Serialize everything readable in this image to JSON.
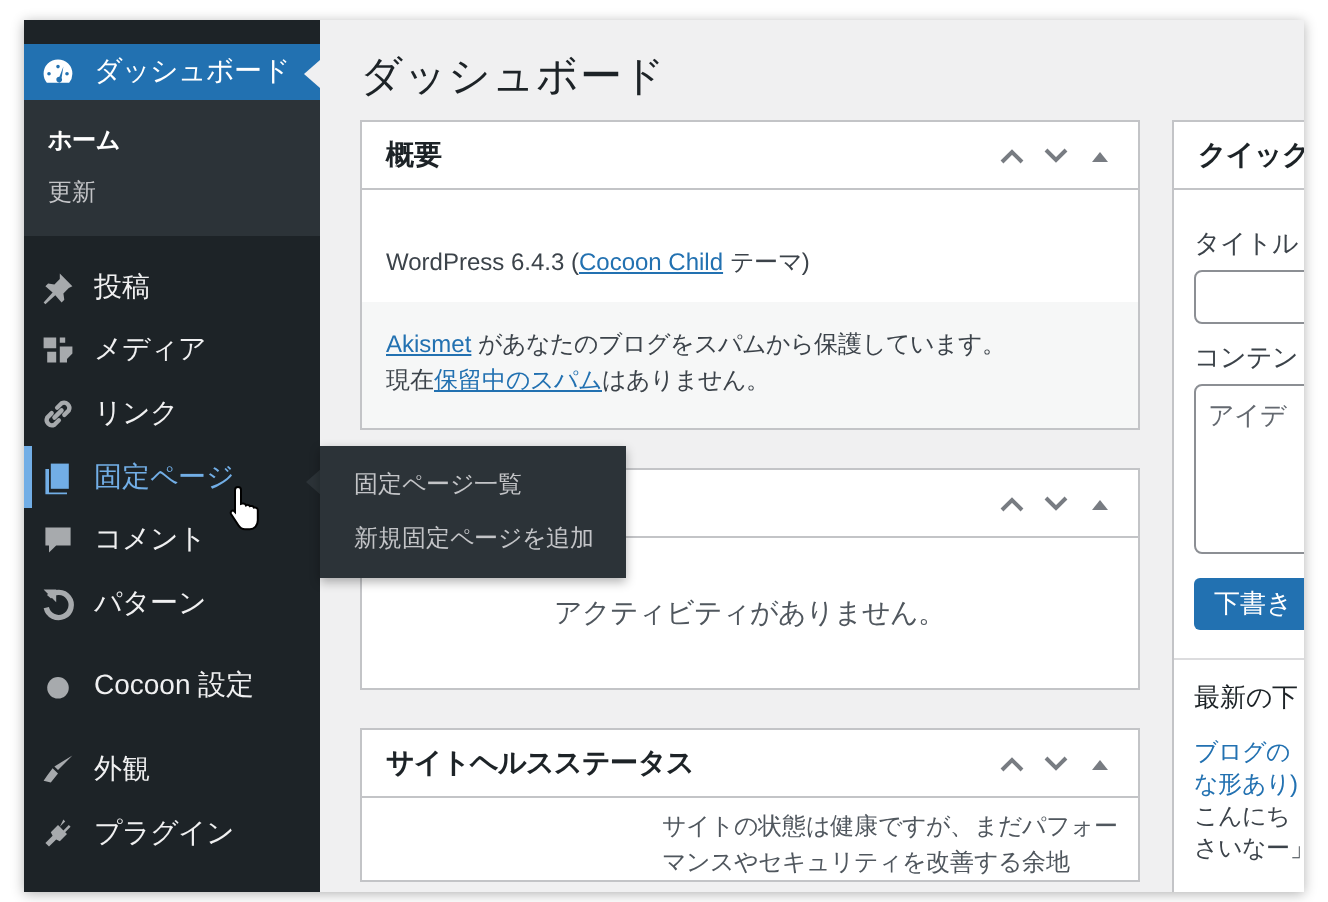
{
  "sidebar": {
    "groups": [
      [
        {
          "label": "ダッシュボード",
          "selected": true,
          "hovered": false,
          "children": [
            {
              "label": "ホーム",
              "selected": true
            },
            {
              "label": "更新",
              "selected": false
            }
          ]
        }
      ],
      [
        {
          "label": "投稿",
          "selected": false,
          "hovered": false
        },
        {
          "label": "メディア",
          "selected": false,
          "hovered": false
        },
        {
          "label": "リンク",
          "selected": false,
          "hovered": false
        },
        {
          "label": "固定ページ",
          "selected": false,
          "hovered": true
        },
        {
          "label": "コメント",
          "selected": false,
          "hovered": false
        },
        {
          "label": "パターン",
          "selected": false,
          "hovered": false
        }
      ],
      [
        {
          "label": "Cocoon 設定",
          "selected": false,
          "hovered": false
        }
      ],
      [
        {
          "label": "外観",
          "selected": false,
          "hovered": false
        },
        {
          "label": "プラグイン",
          "selected": false,
          "hovered": false
        }
      ]
    ],
    "flyout": {
      "items": [
        "固定ページ一覧",
        "新規固定ページを追加"
      ]
    }
  },
  "page_title": "ダッシュボード",
  "left_column": [
    {
      "kind": "overview",
      "title": "概要",
      "lines": [
        [
          {
            "text": "WordPress 6.4.3 ("
          },
          {
            "text": "Cocoon Child",
            "link": true
          },
          {
            "text": " テーマ)"
          }
        ]
      ],
      "notes": [
        [
          {
            "text": "Akismet",
            "link": true
          },
          {
            "text": " があなたのブログをスパムから保護しています。"
          }
        ],
        [
          {
            "text": "現在"
          },
          {
            "text": "保留中のスパム",
            "link": true
          },
          {
            "text": "はありません。"
          }
        ]
      ]
    },
    {
      "kind": "activity",
      "message": "アクティビティがありません。"
    },
    {
      "kind": "health",
      "title": "サイトヘルスステータス",
      "text": "サイトの状態は健康ですが、まだパフォーマンスやセキュリティを改善する余地"
    }
  ],
  "right_column": {
    "title": "クイック",
    "fields": [
      {
        "kind": "input",
        "label": "タイトル"
      },
      {
        "kind": "textarea",
        "label": "コンテン",
        "placeholder": "アイデ"
      }
    ],
    "button": "下書き",
    "drafts_title": "最新の下",
    "draft_link": [
      "ブログの",
      "な形あり)"
    ],
    "draft_excerpt": [
      "こんにち",
      "さいなー」"
    ]
  }
}
